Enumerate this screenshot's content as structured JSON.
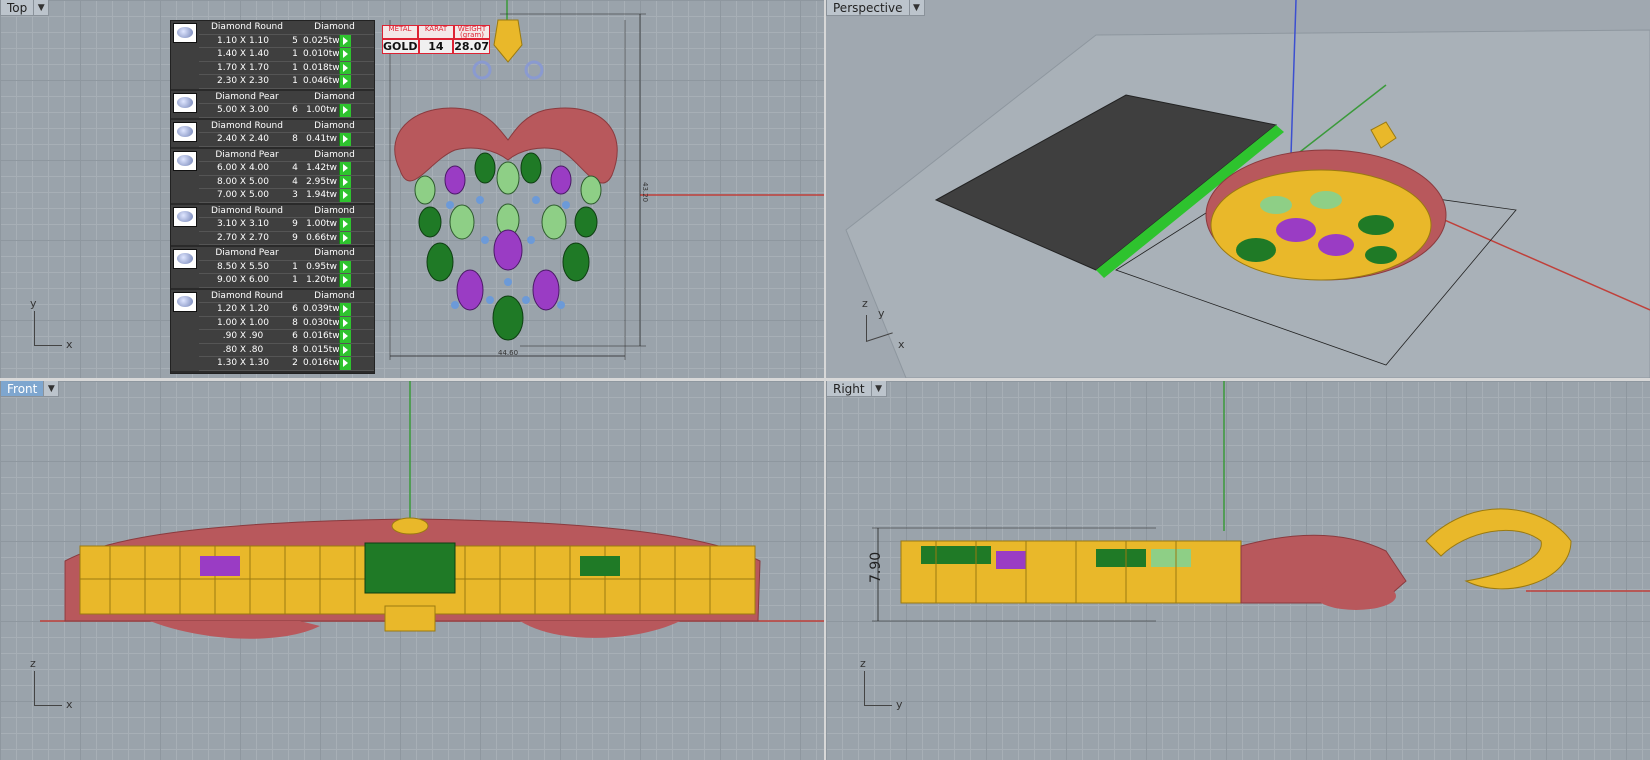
{
  "viewports": {
    "top": {
      "name": "Top"
    },
    "perspective": {
      "name": "Perspective"
    },
    "front": {
      "name": "Front"
    },
    "right": {
      "name": "Right"
    }
  },
  "gem_groups": [
    {
      "shape": "Diamond Round",
      "material": "Diamond",
      "rows": [
        {
          "size": "1.10 X 1.10",
          "qty": "5",
          "weight": "0.025tw"
        },
        {
          "size": "1.40 X 1.40",
          "qty": "1",
          "weight": "0.010tw"
        },
        {
          "size": "1.70 X 1.70",
          "qty": "1",
          "weight": "0.018tw"
        },
        {
          "size": "2.30 X 2.30",
          "qty": "1",
          "weight": "0.046tw"
        }
      ]
    },
    {
      "shape": "Diamond Pear",
      "material": "Diamond",
      "rows": [
        {
          "size": "5.00 X 3.00",
          "qty": "6",
          "weight": "1.00tw"
        }
      ]
    },
    {
      "shape": "Diamond Round",
      "material": "Diamond",
      "rows": [
        {
          "size": "2.40 X 2.40",
          "qty": "8",
          "weight": "0.41tw"
        }
      ]
    },
    {
      "shape": "Diamond Pear",
      "material": "Diamond",
      "rows": [
        {
          "size": "6.00 X 4.00",
          "qty": "4",
          "weight": "1.42tw"
        },
        {
          "size": "8.00 X 5.00",
          "qty": "4",
          "weight": "2.95tw"
        },
        {
          "size": "7.00 X 5.00",
          "qty": "3",
          "weight": "1.94tw"
        }
      ]
    },
    {
      "shape": "Diamond Round",
      "material": "Diamond",
      "rows": [
        {
          "size": "3.10 X 3.10",
          "qty": "9",
          "weight": "1.00tw"
        },
        {
          "size": "2.70 X 2.70",
          "qty": "9",
          "weight": "0.66tw"
        }
      ]
    },
    {
      "shape": "Diamond Pear",
      "material": "Diamond",
      "rows": [
        {
          "size": "8.50 X 5.50",
          "qty": "1",
          "weight": "0.95tw"
        },
        {
          "size": "9.00 X 6.00",
          "qty": "1",
          "weight": "1.20tw"
        }
      ]
    },
    {
      "shape": "Diamond Round",
      "material": "Diamond",
      "rows": [
        {
          "size": "1.20 X 1.20",
          "qty": "6",
          "weight": "0.039tw"
        },
        {
          "size": "1.00 X 1.00",
          "qty": "8",
          "weight": "0.030tw"
        },
        {
          "size": ".90 X .90",
          "qty": "6",
          "weight": "0.016tw"
        },
        {
          "size": ".80 X .80",
          "qty": "8",
          "weight": "0.015tw"
        },
        {
          "size": "1.30 X 1.30",
          "qty": "2",
          "weight": "0.016tw"
        }
      ]
    }
  ],
  "metal": {
    "headers": [
      "METAL",
      "KARAT",
      "WEIGHT (gram)"
    ],
    "values": [
      "GOLD",
      "14",
      "28.07"
    ]
  },
  "dimensions": {
    "top_width": "44.60",
    "top_height": "43.20",
    "right_height": "7.90"
  },
  "axes": {
    "top": [
      "y",
      "x"
    ],
    "perspective": [
      "z",
      "y",
      "x"
    ],
    "front": [
      "z",
      "x"
    ],
    "right": [
      "z",
      "y"
    ]
  },
  "colors": {
    "gold": "#e9b82a",
    "flesh": "#b8585c",
    "emerald": "#1f7a26",
    "light_green": "#8ecf86",
    "amethyst": "#9a3cc4",
    "sapphire": "#6c9ad8"
  }
}
